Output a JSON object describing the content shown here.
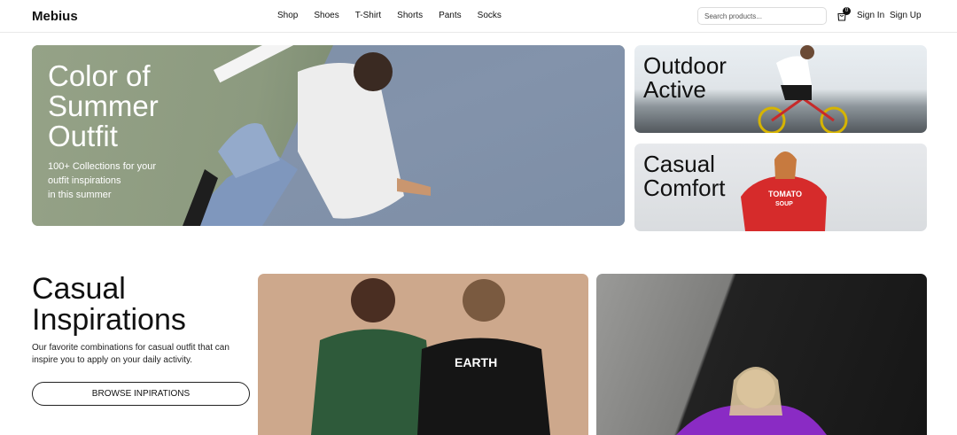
{
  "header": {
    "logo": "Mebius",
    "nav": [
      "Shop",
      "Shoes",
      "T-Shirt",
      "Shorts",
      "Pants",
      "Socks"
    ],
    "search_placeholder": "Search products...",
    "cart_count": "0",
    "sign_in": "Sign In",
    "sign_up": "Sign Up"
  },
  "hero": {
    "title_lines": [
      "Color of",
      "Summer",
      "Outfit"
    ],
    "subtitle_lines": [
      "100+ Collections for your",
      "outfit inspirations",
      "in this summer"
    ]
  },
  "side_cards": [
    {
      "title_lines": [
        "Outdoor",
        "Active"
      ]
    },
    {
      "title_lines": [
        "Casual",
        "Comfort"
      ]
    }
  ],
  "inspirations": {
    "title_lines": [
      "Casual",
      "Inspirations"
    ],
    "description": "Our favorite combinations for casual outfit that can inspire you to apply on your daily activity.",
    "button_label": "BROWSE INPIRATIONS"
  },
  "colors": {
    "hero_green": "#8f9b82",
    "court_blue": "#7f90a8",
    "tan_background": "#cda88c",
    "dark_background": "#161616"
  }
}
